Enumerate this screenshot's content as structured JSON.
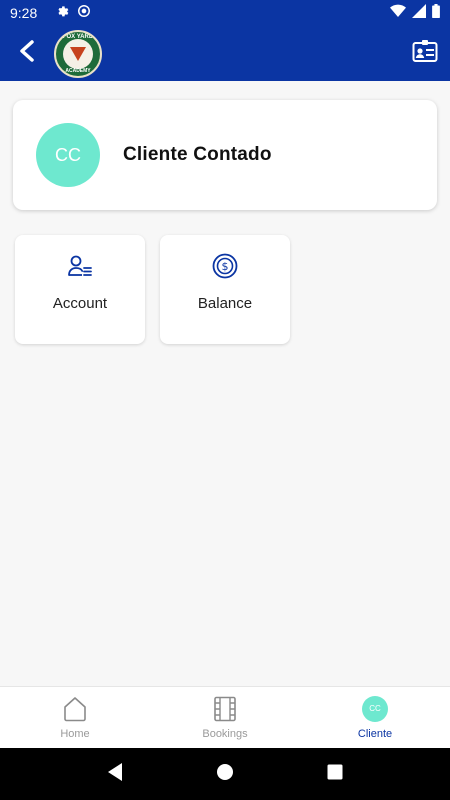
{
  "status_bar": {
    "time": "9:28",
    "icons": [
      "settings-icon",
      "sync-icon",
      "wifi-icon",
      "signal-icon",
      "battery-icon"
    ]
  },
  "app_bar": {
    "back_icon": "chevron-left-icon",
    "logo_top": "FOX YARD",
    "logo_bottom": "ACADEMY",
    "action_icon": "id-card-icon"
  },
  "profile": {
    "initials": "CC",
    "name": "Cliente Contado"
  },
  "tiles": [
    {
      "label": "Account",
      "icon": "user-list-icon"
    },
    {
      "label": "Balance",
      "icon": "dollar-coin-icon"
    }
  ],
  "bottom_nav": {
    "items": [
      {
        "label": "Home",
        "icon": "home-icon",
        "active": false
      },
      {
        "label": "Bookings",
        "icon": "film-icon",
        "active": false
      },
      {
        "label": "Cliente",
        "icon": "avatar",
        "initials": "CC",
        "active": true
      }
    ]
  },
  "colors": {
    "primary": "#0b35a3",
    "avatar": "#6ee8cf",
    "background": "#f7f7f7"
  }
}
